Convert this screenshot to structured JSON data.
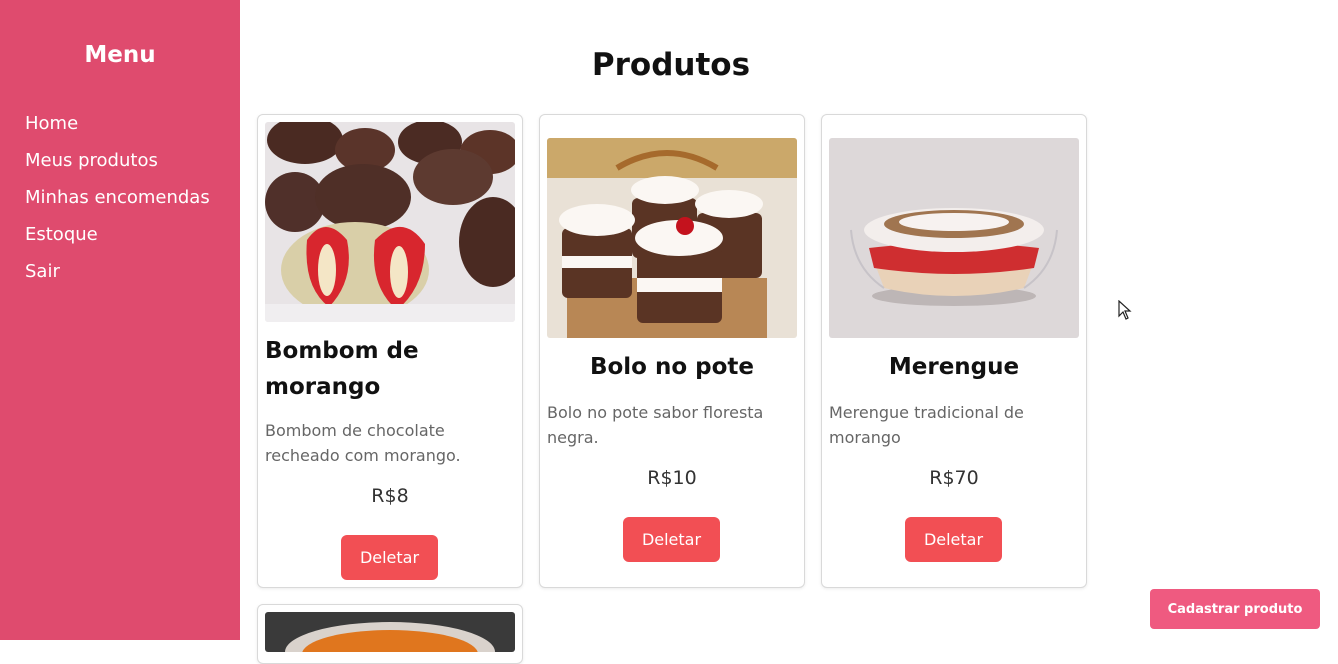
{
  "sidebar": {
    "title": "Menu",
    "items": [
      "Home",
      "Meus produtos",
      "Minhas encomendas",
      "Estoque",
      "Sair"
    ]
  },
  "main": {
    "title": "Produtos",
    "products": [
      {
        "name": "Bombom de morango",
        "description": "Bombom de chocolate recheado com morango.",
        "price": "R$8",
        "delete_label": "Deletar"
      },
      {
        "name": "Bolo no pote",
        "description": "Bolo no pote sabor floresta negra.",
        "price": "R$10",
        "delete_label": "Deletar"
      },
      {
        "name": "Merengue",
        "description": "Merengue tradicional de morango",
        "price": "R$70",
        "delete_label": "Deletar"
      }
    ],
    "add_button": "Cadastrar produto"
  },
  "colors": {
    "sidebar": "#df4b6e",
    "delete_button": "#f24f54",
    "add_button": "#ef5a80"
  }
}
